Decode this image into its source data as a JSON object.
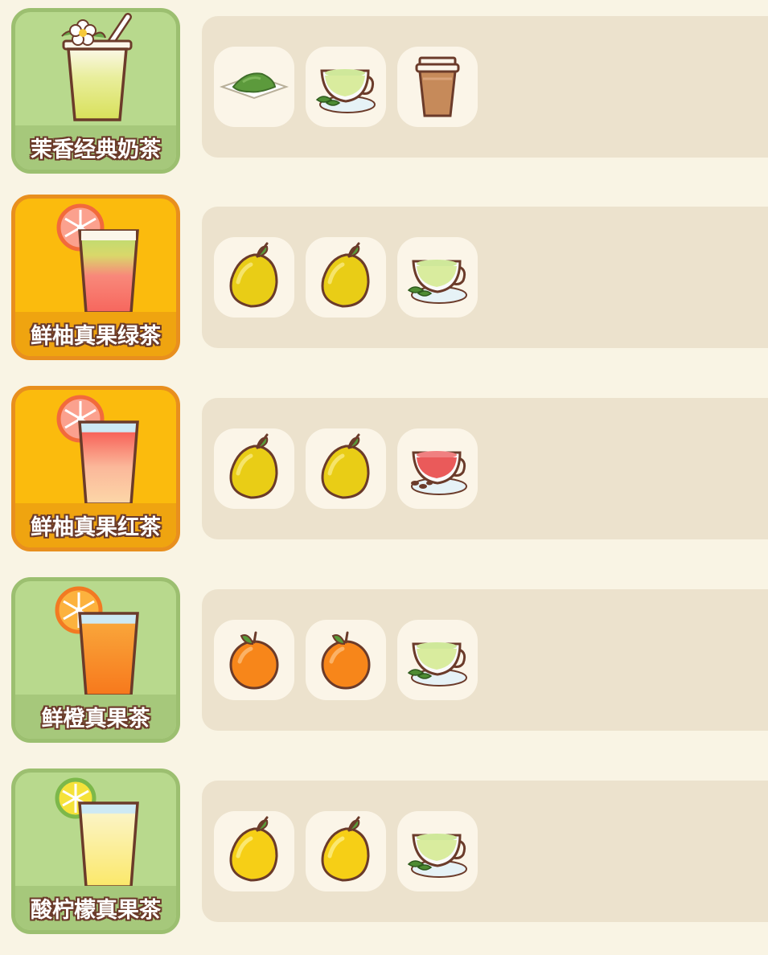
{
  "recipes": [
    {
      "name": "茉香经典奶茶",
      "style": "green",
      "drink_icon": "jasmine-milk-tea-icon",
      "ingredients": [
        "matcha-powder-icon",
        "green-tea-cup-icon",
        "milk-tea-cup-icon"
      ]
    },
    {
      "name": "鲜柚真果绿茶",
      "style": "gold",
      "drink_icon": "grapefruit-green-tea-icon",
      "ingredients": [
        "pomelo-icon",
        "pomelo-icon",
        "green-tea-cup-icon"
      ]
    },
    {
      "name": "鲜柚真果红茶",
      "style": "gold",
      "drink_icon": "grapefruit-black-tea-icon",
      "ingredients": [
        "pomelo-icon",
        "pomelo-icon",
        "black-tea-cup-icon"
      ]
    },
    {
      "name": "鲜橙真果茶",
      "style": "green",
      "drink_icon": "orange-fruit-tea-icon",
      "ingredients": [
        "orange-icon",
        "orange-icon",
        "green-tea-cup-icon"
      ]
    },
    {
      "name": "酸柠檬真果茶",
      "style": "green",
      "drink_icon": "lemon-fruit-tea-icon",
      "ingredients": [
        "lemon-icon",
        "lemon-icon",
        "green-tea-cup-icon"
      ]
    }
  ],
  "colors": {
    "background": "#f9f4e4",
    "panel": "#ece2cd",
    "slot": "#fbf5e8",
    "card_green": "#b8d98d",
    "card_gold": "#fbbb0d",
    "outline": "#6b3b2a"
  }
}
